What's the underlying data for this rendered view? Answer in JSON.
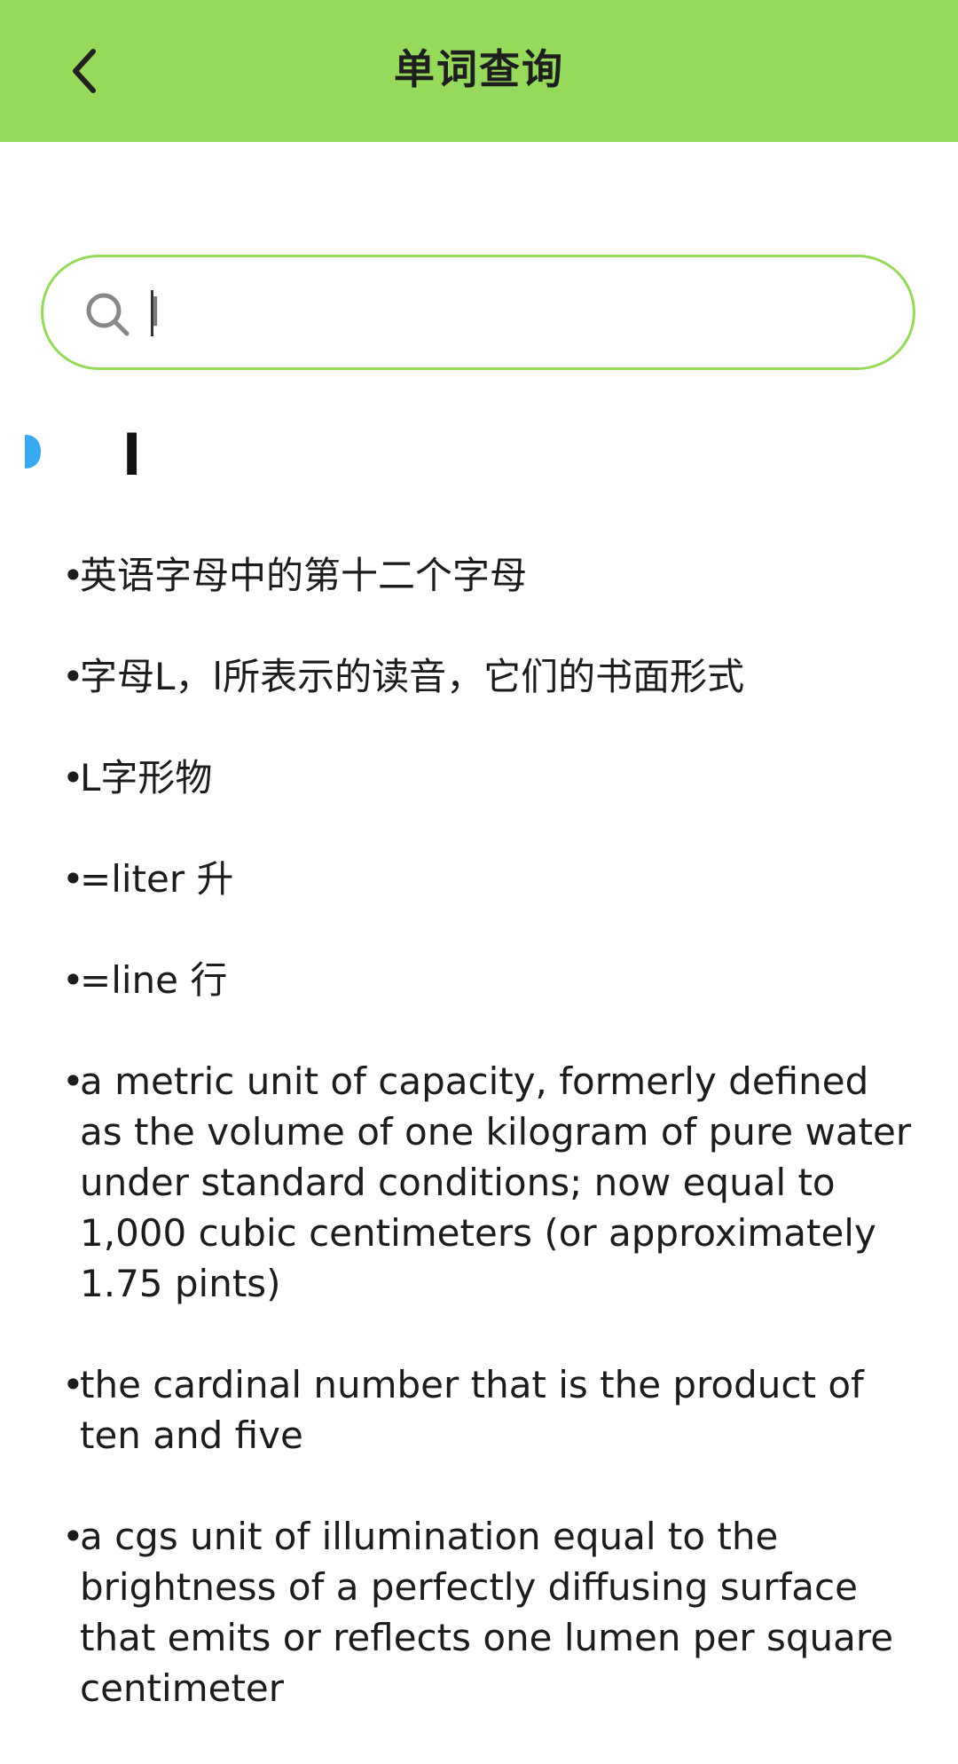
{
  "header": {
    "title": "单词查询",
    "back_icon": "chevron-left-icon",
    "background_color": "#95da5a"
  },
  "search": {
    "value": "l",
    "icon": "search-icon",
    "border_color": "#95da5a"
  },
  "word": {
    "text": "l",
    "sound_icon": "speaker-icon",
    "sound_icon_color": "#3aa8f0"
  },
  "definitions": [
    {
      "bullet": "•",
      "text": "英语字母中的第十二个字母"
    },
    {
      "bullet": "•",
      "text": "字母L，l所表示的读音，它们的书面形式"
    },
    {
      "bullet": "•",
      "text": "L字形物"
    },
    {
      "bullet": "•",
      "text": "=liter 升"
    },
    {
      "bullet": "•",
      "text": "=line 行"
    },
    {
      "bullet": "•",
      "text": "a metric unit of capacity, formerly defined as the volume of one kilogram of pure water under standard conditions; now equal to 1,000 cubic centimeters (or approximately 1.75 pints)"
    },
    {
      "bullet": "•",
      "text": "the cardinal number that is the product of ten and five"
    },
    {
      "bullet": "•",
      "text": "a cgs unit of illumination equal to the brightness of a perfectly diffusing surface that emits or reflects one lumen per square centimeter"
    }
  ]
}
